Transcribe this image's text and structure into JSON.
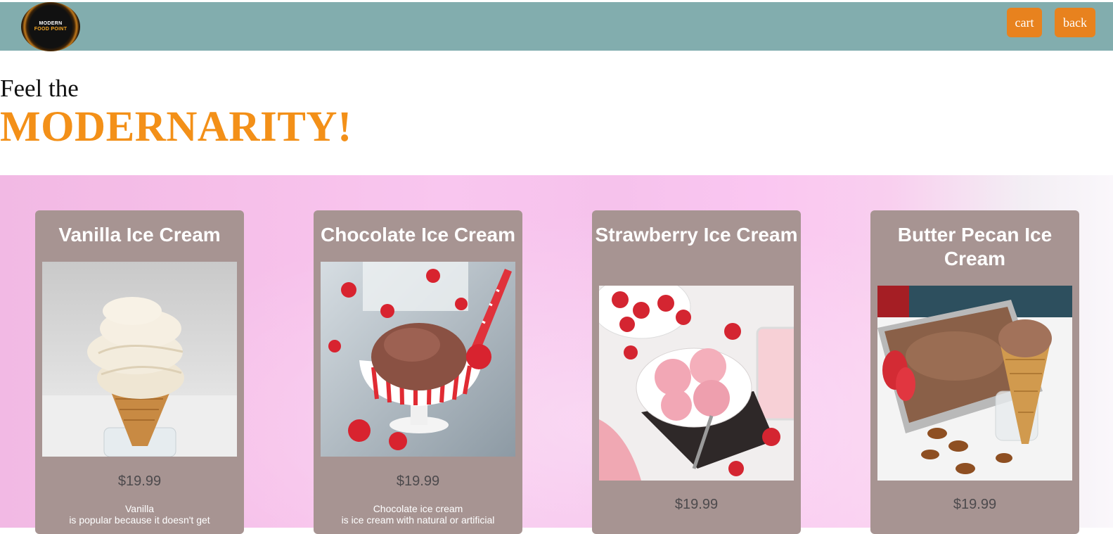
{
  "header": {
    "logo_line1": "MODERN",
    "logo_line2": "FOOD POINT",
    "cart_label": "cart",
    "back_label": "back"
  },
  "hero": {
    "line1": "Feel the",
    "line2": "MODERNARITY!"
  },
  "products": [
    {
      "title": "Vanilla Ice Cream",
      "price": "$19.99",
      "desc_line1": "Vanilla",
      "desc_line2": "is popular because it doesn't get"
    },
    {
      "title": "Chocolate Ice Cream",
      "price": "$19.99",
      "desc_line1": "Chocolate ice cream",
      "desc_line2": "is ice cream with natural or artificial"
    },
    {
      "title": "Strawberry Ice Cream",
      "price": "$19.99"
    },
    {
      "title": "Butter Pecan Ice Cream",
      "price": "$19.99"
    }
  ],
  "colors": {
    "topbar": "#82adae",
    "button": "#e8821e",
    "accent": "#f39018",
    "card": "#a79492",
    "band": "#f6c2ec"
  }
}
